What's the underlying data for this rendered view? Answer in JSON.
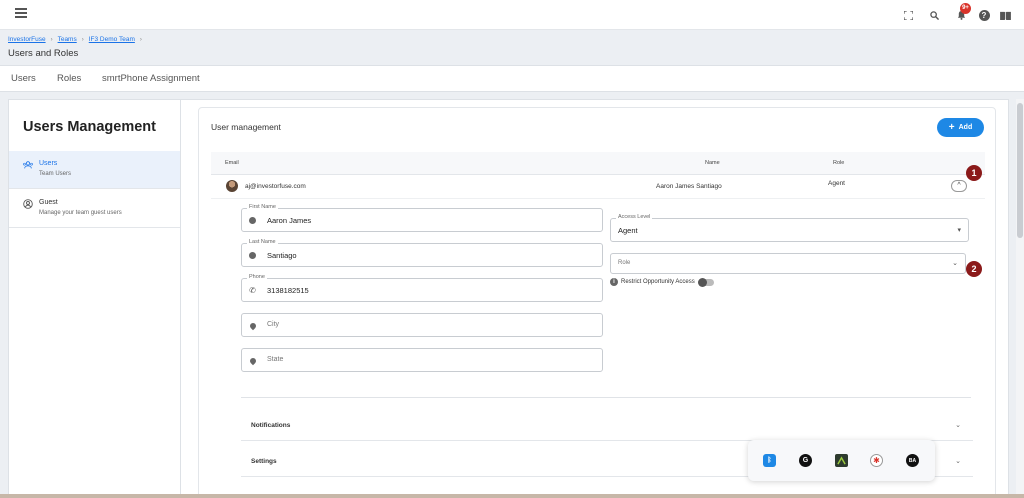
{
  "topbar": {
    "icons": [
      "hamburger-icon",
      "fullscreen-icon",
      "search-icon",
      "bell-icon",
      "help-icon",
      "book-icon"
    ],
    "notification_count": "9+"
  },
  "breadcrumb": {
    "items": [
      "InvestorFuse",
      "Teams",
      "IF3 Demo Team"
    ],
    "title": "Users and Roles"
  },
  "tabs": [
    "Users",
    "Roles",
    "smrtPhone Assignment"
  ],
  "sidebar": {
    "title": "Users Management",
    "items": [
      {
        "name": "Users",
        "sub": "Team Users",
        "icon": "users-icon",
        "active": true
      },
      {
        "name": "Guest",
        "sub": "Manage your team guest users",
        "icon": "guest-icon",
        "active": false
      }
    ]
  },
  "panel": {
    "title": "User management",
    "add_label": "Add",
    "columns": {
      "email": "Email",
      "name": "Name",
      "role": "Role"
    },
    "user": {
      "email": "aj@investorfuse.com",
      "name": "Aaron James  Santiago",
      "role": "Agent",
      "expand": "^"
    },
    "form": {
      "first_name": {
        "label": "First Name",
        "value": "Aaron James"
      },
      "last_name": {
        "label": "Last Name",
        "value": "Santiago"
      },
      "phone": {
        "label": "Phone",
        "value": "3138182515"
      },
      "city": {
        "placeholder": "City"
      },
      "state": {
        "placeholder": "State"
      },
      "access_level": {
        "label": "Access Level",
        "value": "Agent"
      },
      "role": {
        "placeholder": "Role"
      },
      "restrict_label": "Restrict Opportunity Access",
      "restrict_on": false
    },
    "sections": [
      "Notifications",
      "Settings"
    ]
  },
  "callouts": [
    "1",
    "2"
  ],
  "tray_icons": [
    "bluetooth-icon",
    "grammarly-icon",
    "app-icon",
    "slack-icon",
    "bambu-icon"
  ]
}
